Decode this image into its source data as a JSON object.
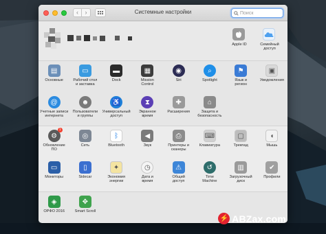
{
  "window": {
    "title": "Системные настройки"
  },
  "search": {
    "placeholder": "Поиск"
  },
  "account": {
    "apple_id_label": "Apple ID",
    "family_label": "Семейный\nдоступ"
  },
  "section1": [
    {
      "label": "Основные",
      "icon": "general-icon",
      "color": "#6b8fb8"
    },
    {
      "label": "Рабочий стол\nи заставка",
      "icon": "desktop-icon",
      "color": "#3a9be0"
    },
    {
      "label": "Dock",
      "icon": "dock-icon",
      "color": "#2b2b2b"
    },
    {
      "label": "Mission\nControl",
      "icon": "mission-control-icon",
      "color": "#3c3c3c"
    },
    {
      "label": "Siri",
      "icon": "siri-icon",
      "color": "#2c2c54"
    },
    {
      "label": "Spotlight",
      "icon": "spotlight-icon",
      "color": "#1f8fe8"
    },
    {
      "label": "Язык и\nрегион",
      "icon": "language-icon",
      "color": "#3a7bd5"
    },
    {
      "label": "Уведомления",
      "icon": "notifications-icon",
      "color": "#d9d9d9"
    },
    {
      "label": "Учетные записи\nинтернета",
      "icon": "internet-accounts-icon",
      "color": "#2b8be0"
    },
    {
      "label": "Пользователи\nи группы",
      "icon": "users-icon",
      "color": "#7a7a7a"
    },
    {
      "label": "Универсальный\nдоступ",
      "icon": "accessibility-icon",
      "color": "#1e7fd9"
    },
    {
      "label": "Экранное\nвремя",
      "icon": "screen-time-icon",
      "color": "#5b3fb5"
    },
    {
      "label": "Расширения",
      "icon": "extensions-icon",
      "color": "#9a9a9a"
    },
    {
      "label": "Защита и\nбезопасность",
      "icon": "security-icon",
      "color": "#8a8a8a"
    }
  ],
  "section2": [
    {
      "label": "Обновление\nПО",
      "icon": "software-update-icon",
      "color": "#5a5a5a",
      "badge": "1"
    },
    {
      "label": "Сеть",
      "icon": "network-icon",
      "color": "#7d8794"
    },
    {
      "label": "Bluetooth",
      "icon": "bluetooth-icon",
      "color": "#ffffff"
    },
    {
      "label": "Звук",
      "icon": "sound-icon",
      "color": "#7a7a7a"
    },
    {
      "label": "Принтеры и\nсканеры",
      "icon": "printer-icon",
      "color": "#8c8c8c"
    },
    {
      "label": "Клавиатура",
      "icon": "keyboard-icon",
      "color": "#d0d0d0"
    },
    {
      "label": "Трекпад",
      "icon": "trackpad-icon",
      "color": "#bdbdbd"
    },
    {
      "label": "Мышь",
      "icon": "mouse-icon",
      "color": "#f2f2f2"
    },
    {
      "label": "Мониторы",
      "icon": "displays-icon",
      "color": "#2b5fa8"
    },
    {
      "label": "Sidecar",
      "icon": "sidecar-icon",
      "color": "#3b6fd0"
    },
    {
      "label": "Экономия\nэнергии",
      "icon": "energy-saver-icon",
      "color": "#f4e4a1"
    },
    {
      "label": "Дата и\nвремя",
      "icon": "date-time-icon",
      "color": "#f4f4f4"
    },
    {
      "label": "Общий\nдоступ",
      "icon": "sharing-icon",
      "color": "#3d86d8"
    },
    {
      "label": "Time\nMachine",
      "icon": "time-machine-icon",
      "color": "#2e6d6b"
    },
    {
      "label": "Загрузочный\nдиск",
      "icon": "startup-disk-icon",
      "color": "#9a9a9a"
    },
    {
      "label": "Профили",
      "icon": "profiles-icon",
      "color": "#a0a0a0"
    }
  ],
  "section3": [
    {
      "label": "ОРФО 2016",
      "icon": "orfo-icon",
      "color": "#2f9a49"
    },
    {
      "label": "Smart Scroll",
      "icon": "smart-scroll-icon",
      "color": "#3fa34d"
    }
  ],
  "watermark": {
    "text": "ABZax.com"
  }
}
